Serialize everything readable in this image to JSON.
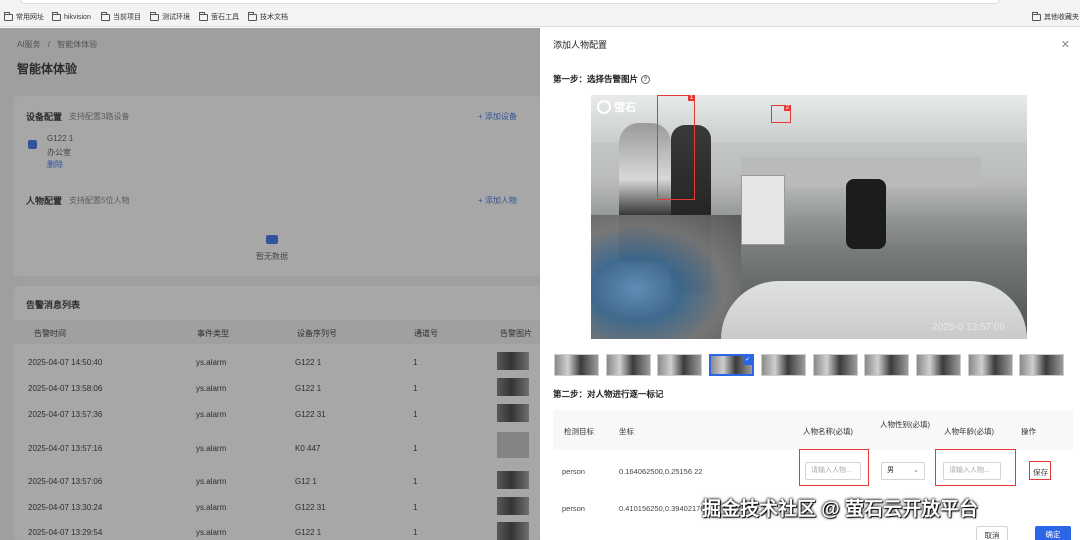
{
  "bookmarks": {
    "left": [
      "常用网址",
      "hikvision",
      "当前项目",
      "测试环境",
      "萤石工具",
      "技术文档"
    ],
    "right": "其他收藏夹"
  },
  "background": {
    "breadcrumb": [
      "AI服务",
      "/",
      "智能体体验"
    ],
    "page_title": "智能体体验",
    "device_config": {
      "title": "设备配置",
      "hint": "支持配置3路设备",
      "add": "+ 添加设备",
      "device_serial": "G122      1",
      "device_name": "办公室",
      "delete": "删除"
    },
    "person_config": {
      "title": "人物配置",
      "hint": "支持配置5位人物",
      "add": "+ 添加人物",
      "empty": "暂无数据"
    },
    "alarm_list": {
      "title": "告警消息列表",
      "headers": [
        "告警时间",
        "事件类型",
        "设备序列号",
        "通道号",
        "告警图片"
      ],
      "rows": [
        [
          "2025-04-07 14:50:40",
          "ys.alarm",
          "G122     1",
          "1"
        ],
        [
          "2025-04-07 13:58:06",
          "ys.alarm",
          "G122     1",
          "1"
        ],
        [
          "2025-04-07 13:57:36",
          "ys.alarm",
          "G122     31",
          "1"
        ],
        [
          "2025-04-07 13:57:16",
          "ys.alarm",
          "K0      447",
          "1"
        ],
        [
          "2025-04-07 13:57:06",
          "ys.alarm",
          "G12      1",
          "1"
        ],
        [
          "2025-04-07 13:30:24",
          "ys.alarm",
          "G122     31",
          "1"
        ],
        [
          "2025-04-07 13:29:54",
          "ys.alarm",
          "G122     1",
          "1"
        ]
      ]
    }
  },
  "drawer": {
    "title": "添加人物配置",
    "step1": "第一步：选择告警图片",
    "hint_icon": "?",
    "camera": {
      "logo": "萤石",
      "timestamp": "2025-0      13:57:06",
      "box1": "1",
      "box2": "2"
    },
    "step2": "第二步：对人物进行逐一标记",
    "table": {
      "headers": [
        "检测目标",
        "坐标",
        "人物名称(必填)",
        "人物性别(必填)",
        "人物年龄(必填)",
        "操作"
      ],
      "rows": [
        {
          "target": "person",
          "coords": "0.164062500,0.25156              22",
          "name_placeholder": "请输入人物...",
          "gender": "男",
          "age_placeholder": "请输入人物...",
          "action": "保存"
        },
        {
          "target": "person",
          "coords": "0.410156250,0.39402176"
        }
      ]
    },
    "cancel": "取消",
    "ok": "确定"
  },
  "watermark": "掘金技术社区 @ 萤石云开放平台",
  "colors": {
    "accent": "#2b66e6",
    "highlight_red": "#e53935"
  }
}
